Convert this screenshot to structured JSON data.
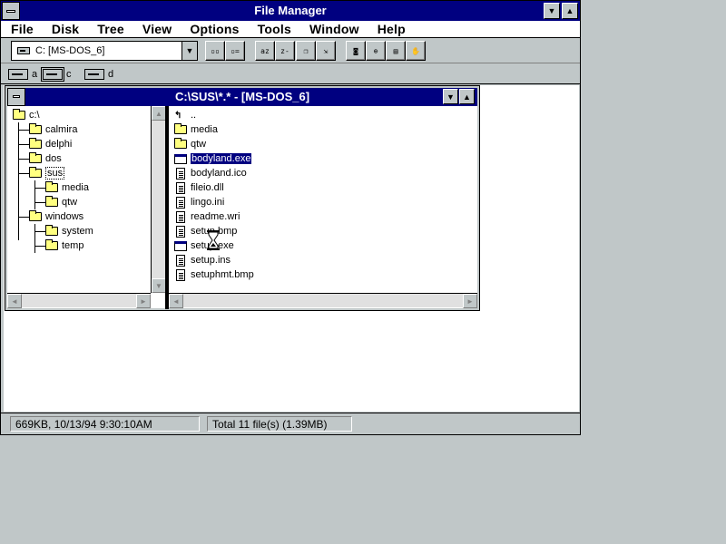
{
  "window": {
    "title": "File Manager"
  },
  "menu": [
    "File",
    "Disk",
    "Tree",
    "View",
    "Options",
    "Tools",
    "Window",
    "Help"
  ],
  "toolbar": {
    "drive_combo_value": "C: [MS-DOS_6]",
    "buttons": [
      "list-icons-button",
      "details-button",
      "sort-name-button",
      "sort-type-button",
      "copy-button",
      "move-button",
      "connect-drive-button",
      "disconnect-drive-button",
      "share-button",
      "stop-share-button"
    ]
  },
  "drives": [
    {
      "letter": "a",
      "selected": false
    },
    {
      "letter": "c",
      "selected": true
    },
    {
      "letter": "d",
      "selected": false
    }
  ],
  "child_window": {
    "title": "C:\\SUS\\*.* - [MS-DOS_6]",
    "tree": [
      {
        "label": "c:\\",
        "level": 0
      },
      {
        "label": "calmira",
        "level": 1
      },
      {
        "label": "delphi",
        "level": 1
      },
      {
        "label": "dos",
        "level": 1
      },
      {
        "label": "sus",
        "level": 1,
        "open": true,
        "selected": true
      },
      {
        "label": "media",
        "level": 2
      },
      {
        "label": "qtw",
        "level": 2
      },
      {
        "label": "windows",
        "level": 1
      },
      {
        "label": "system",
        "level": 2
      },
      {
        "label": "temp",
        "level": 2
      }
    ],
    "files": [
      {
        "name": "..",
        "type": "up"
      },
      {
        "name": "media",
        "type": "folder"
      },
      {
        "name": "qtw",
        "type": "folder"
      },
      {
        "name": "bodyland.exe",
        "type": "exe",
        "selected": true
      },
      {
        "name": "bodyland.ico",
        "type": "doc"
      },
      {
        "name": "fileio.dll",
        "type": "doc"
      },
      {
        "name": "lingo.ini",
        "type": "doc"
      },
      {
        "name": "readme.wri",
        "type": "doc"
      },
      {
        "name": "setup.bmp",
        "type": "doc"
      },
      {
        "name": "setup.exe",
        "type": "exe"
      },
      {
        "name": "setup.ins",
        "type": "doc"
      },
      {
        "name": "setuphmt.bmp",
        "type": "doc"
      }
    ]
  },
  "status": {
    "left": "669KB, 10/13/94 9:30:10AM",
    "right": "Total 11 file(s) (1.39MB)"
  }
}
